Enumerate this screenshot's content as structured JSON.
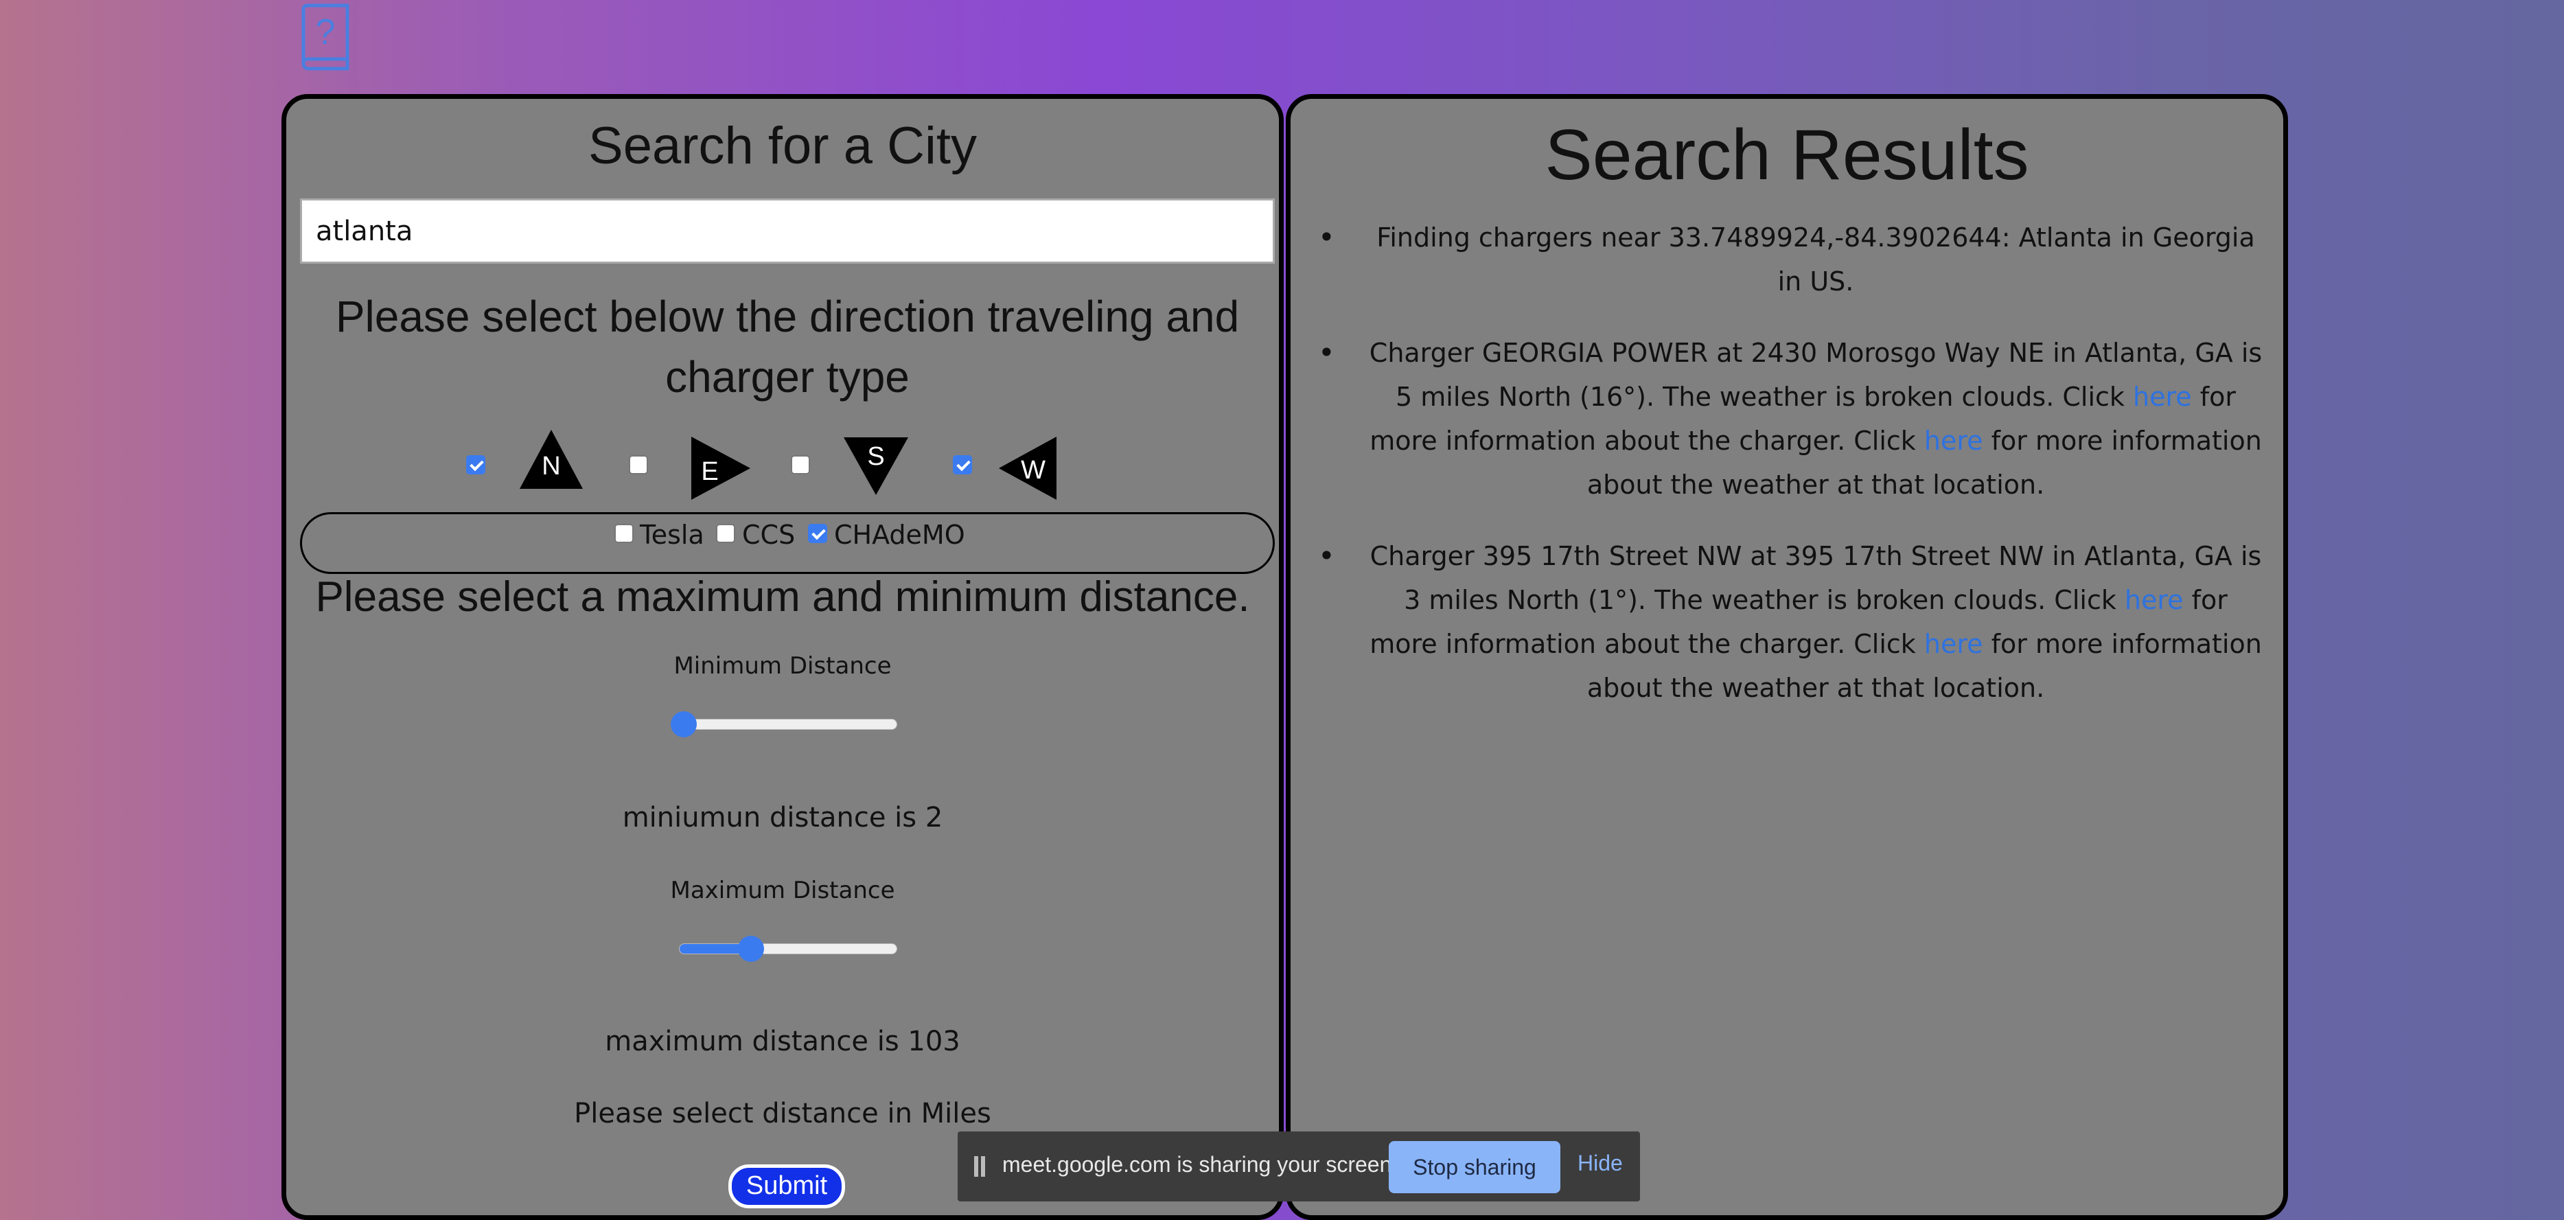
{
  "left": {
    "title": "Search for a City",
    "search_value": "atlanta",
    "direction_text": "Please select below the direction traveling and charger type",
    "directions": [
      {
        "letter": "N",
        "checked": true
      },
      {
        "letter": "E",
        "checked": false
      },
      {
        "letter": "S",
        "checked": false
      },
      {
        "letter": "W",
        "checked": true
      }
    ],
    "chargers": [
      {
        "label": "Tesla",
        "checked": false
      },
      {
        "label": "CCS",
        "checked": false
      },
      {
        "label": "CHAdeMO",
        "checked": true
      }
    ],
    "distance_prompt": "Please select a maximum and minimum distance.",
    "min_label": "Minimum Distance",
    "min_level": 0.02,
    "min_text": "miniumun distance is 2",
    "max_label": "Maximum Distance",
    "max_level": 0.33,
    "max_text": "maximum distance is 103",
    "units_text": "Please select distance in Miles",
    "submit_label": "Submit"
  },
  "right": {
    "title": "Search Results",
    "results": [
      {
        "parts": [
          "Finding chargers near 33.7489924,-84.3902644: Atlanta in Georgia in US."
        ]
      },
      {
        "parts": [
          "Charger GEORGIA POWER at 2430 Morosgo Way NE in Atlanta, GA is 5 miles North (16°). The weather is broken clouds. Click ",
          "here",
          " for more information about the charger. Click ",
          "here",
          " for more information about the weather at that location."
        ]
      },
      {
        "parts": [
          "Charger 395 17th Street NW at 395 17th Street NW in Atlanta, GA is 3 miles North (1°). The weather is broken clouds. Click ",
          "here",
          " for more information about the charger. Click ",
          "here",
          " for more information about the weather at that location."
        ]
      }
    ]
  },
  "share_bar": {
    "text": "meet.google.com is sharing your screen.",
    "stop_label": "Stop sharing",
    "hide_label": "Hide"
  },
  "icons": {
    "help": "help-book-icon",
    "pause": "pause-icon"
  },
  "colors": {
    "accent": "#3b7bf0",
    "link": "#2e72e0",
    "submit": "#1230e8",
    "panel": "#808080"
  }
}
